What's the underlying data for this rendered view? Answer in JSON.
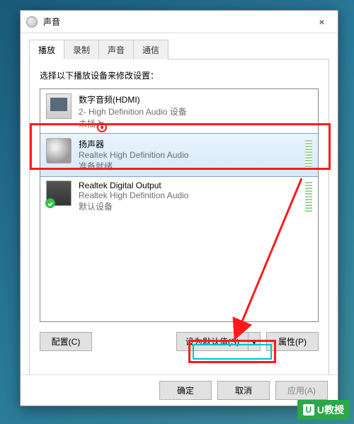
{
  "window": {
    "title": "声音",
    "close": "×"
  },
  "tabs": {
    "playback": "播放",
    "recording": "录制",
    "sounds": "声音",
    "communications": "通信"
  },
  "instruction": "选择以下播放设备来修改设置：",
  "devices": [
    {
      "name": "数字音频(HDMI)",
      "driver": "2- High Definition Audio 设备",
      "status": "未插入"
    },
    {
      "name": "扬声器",
      "driver": "Realtek High Definition Audio",
      "status": "准备就绪"
    },
    {
      "name": "Realtek Digital Output",
      "driver": "Realtek High Definition Audio",
      "status": "默认设备"
    }
  ],
  "buttons": {
    "configure": "配置(C)",
    "set_default": "设为默认值(S)",
    "dropdown_glyph": "▼",
    "properties": "属性(P)",
    "ok": "确定",
    "cancel": "取消",
    "apply": "应用(A)"
  },
  "watermark": "ngya.baidu.Com",
  "brand": "U教授"
}
